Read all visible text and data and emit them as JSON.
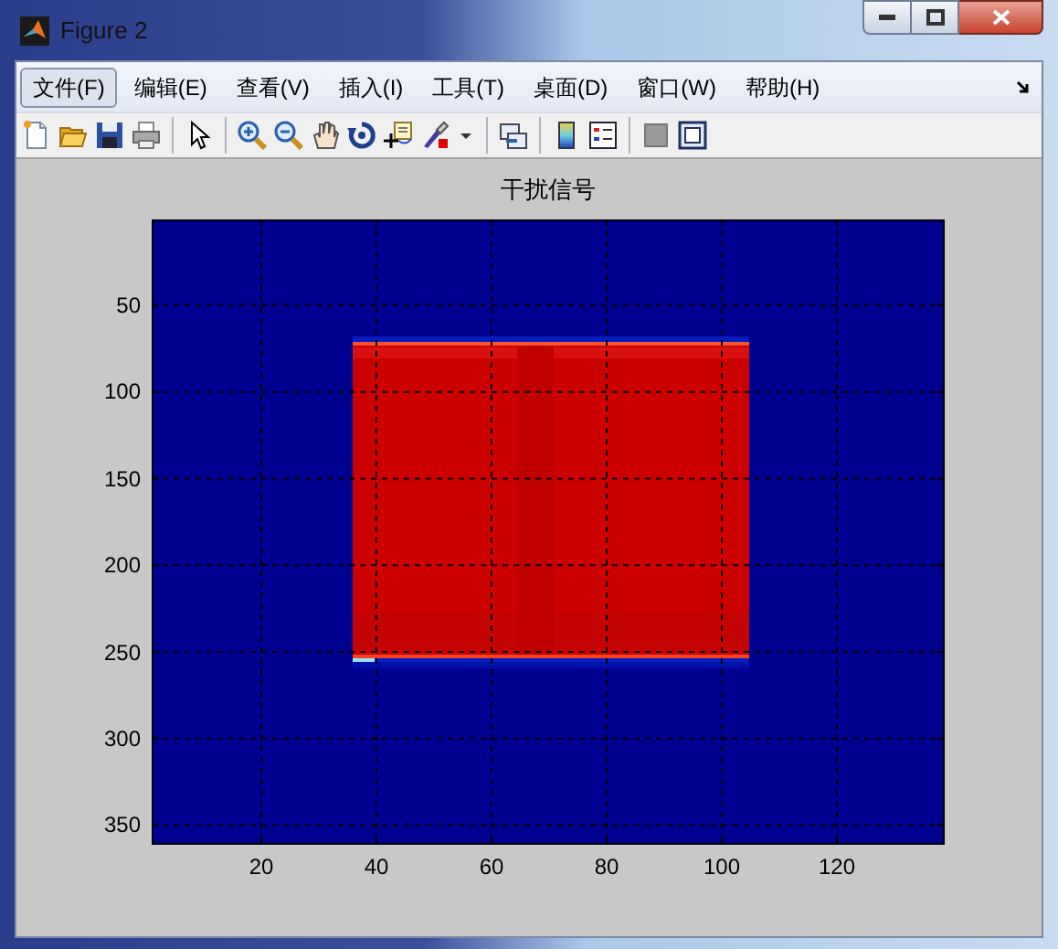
{
  "window": {
    "title": "Figure 2"
  },
  "menu": [
    {
      "label": "文件(F)",
      "selected": true
    },
    {
      "label": "编辑(E)",
      "selected": false
    },
    {
      "label": "查看(V)",
      "selected": false
    },
    {
      "label": "插入(I)",
      "selected": false
    },
    {
      "label": "工具(T)",
      "selected": false
    },
    {
      "label": "桌面(D)",
      "selected": false
    },
    {
      "label": "窗口(W)",
      "selected": false
    },
    {
      "label": "帮助(H)",
      "selected": false
    }
  ],
  "toolbar": [
    {
      "kind": "new"
    },
    {
      "kind": "open"
    },
    {
      "kind": "save"
    },
    {
      "kind": "print"
    },
    {
      "kind": "separator"
    },
    {
      "kind": "pointer"
    },
    {
      "kind": "separator"
    },
    {
      "kind": "zoom-in"
    },
    {
      "kind": "zoom-out"
    },
    {
      "kind": "pan"
    },
    {
      "kind": "rotate"
    },
    {
      "kind": "data-cursor"
    },
    {
      "kind": "brush"
    },
    {
      "kind": "caret"
    },
    {
      "kind": "separator"
    },
    {
      "kind": "link"
    },
    {
      "kind": "separator"
    },
    {
      "kind": "colorbar"
    },
    {
      "kind": "legend"
    },
    {
      "kind": "separator"
    },
    {
      "kind": "hide-tools"
    },
    {
      "kind": "show-tools"
    }
  ],
  "plot": {
    "title": "干扰信号",
    "yticks": [
      "50",
      "100",
      "150",
      "200",
      "250",
      "300",
      "350"
    ],
    "xticks": [
      "20",
      "40",
      "60",
      "80",
      "100",
      "120"
    ]
  }
}
